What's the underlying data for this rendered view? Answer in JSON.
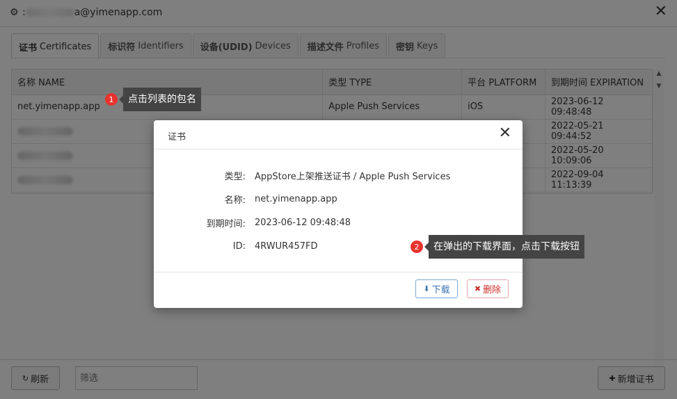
{
  "window": {
    "title_prefix": ":",
    "title_suffix": "a@yimenapp.com"
  },
  "tabs": [
    {
      "cn": "证书",
      "en": "Certificates"
    },
    {
      "cn": "标识符",
      "en": "Identifiers"
    },
    {
      "cn": "设备(UDID)",
      "en": "Devices"
    },
    {
      "cn": "描述文件",
      "en": "Profiles"
    },
    {
      "cn": "密钥",
      "en": "Keys"
    }
  ],
  "table": {
    "headers": [
      "名称 NAME",
      "类型 TYPE",
      "平台 PLATFORM",
      "到期时间 EXPIRATION"
    ],
    "rows": [
      {
        "name": "net.yimenapp.app",
        "type": "Apple Push Services",
        "platform": "iOS",
        "expiration": "2023-06-12 09:48:48"
      },
      {
        "name": "",
        "type": "",
        "platform": "",
        "expiration": "2022-05-21 09:44:52"
      },
      {
        "name": "",
        "type": "",
        "platform": "",
        "expiration": "2022-05-20 10:09:06"
      },
      {
        "name": "",
        "type": "",
        "platform": "",
        "expiration": "2022-09-04 11:13:39"
      }
    ]
  },
  "toolbar": {
    "refresh_label": "刷新",
    "filter_placeholder": "筛选",
    "add_label": "新增证书"
  },
  "callouts": {
    "step1_num": "1",
    "step1_text": "点击列表的包名",
    "step2_num": "2",
    "step2_text": "在弹出的下载界面，点击下载按钮"
  },
  "modal": {
    "title": "证书",
    "fields": [
      {
        "label": "类型:",
        "value": "AppStore上架推送证书 / Apple Push Services"
      },
      {
        "label": "名称:",
        "value": "net.yimenapp.app"
      },
      {
        "label": "到期时间:",
        "value": "2023-06-12 09:48:48"
      },
      {
        "label": "ID:",
        "value": "4RWUR457FD"
      }
    ],
    "download_label": "下载",
    "delete_label": "删除"
  },
  "colors": {
    "badge": "#e8332f",
    "callout_bg": "#444444",
    "download_border": "#7aa8d4",
    "delete_text": "#c9302c"
  }
}
